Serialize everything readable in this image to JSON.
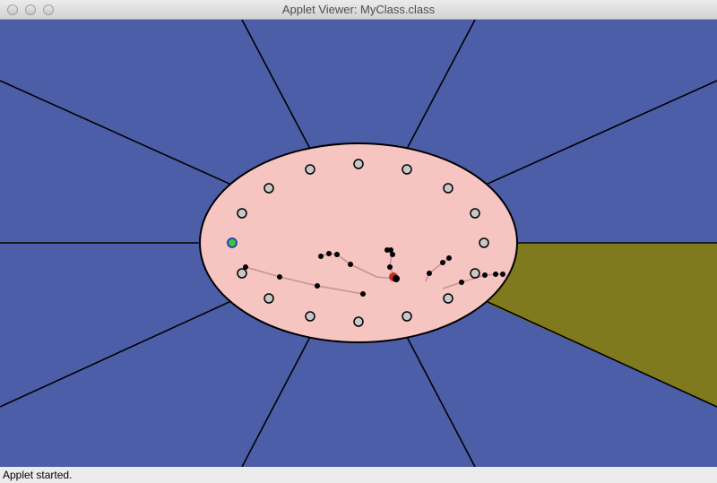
{
  "window": {
    "title": "Applet Viewer: MyClass.class",
    "controls": [
      "close-icon",
      "minimize-icon",
      "zoom-icon"
    ]
  },
  "applet": {
    "colors": {
      "background": "#4c5ea7",
      "highlight_sector": "#807a1e",
      "ellipse": "#f6c5c2",
      "lines": "#000000",
      "ring_node_fill": "#c8c8c8",
      "active_node": "#3fc23f",
      "active_node_border": "#1b3fb0",
      "particle": "#000000",
      "trail": "#c79392",
      "target": "#cc2b1f"
    },
    "ring_node_count": 16,
    "highlighted_sector": "right-lower"
  },
  "status": {
    "text": "Applet started."
  }
}
